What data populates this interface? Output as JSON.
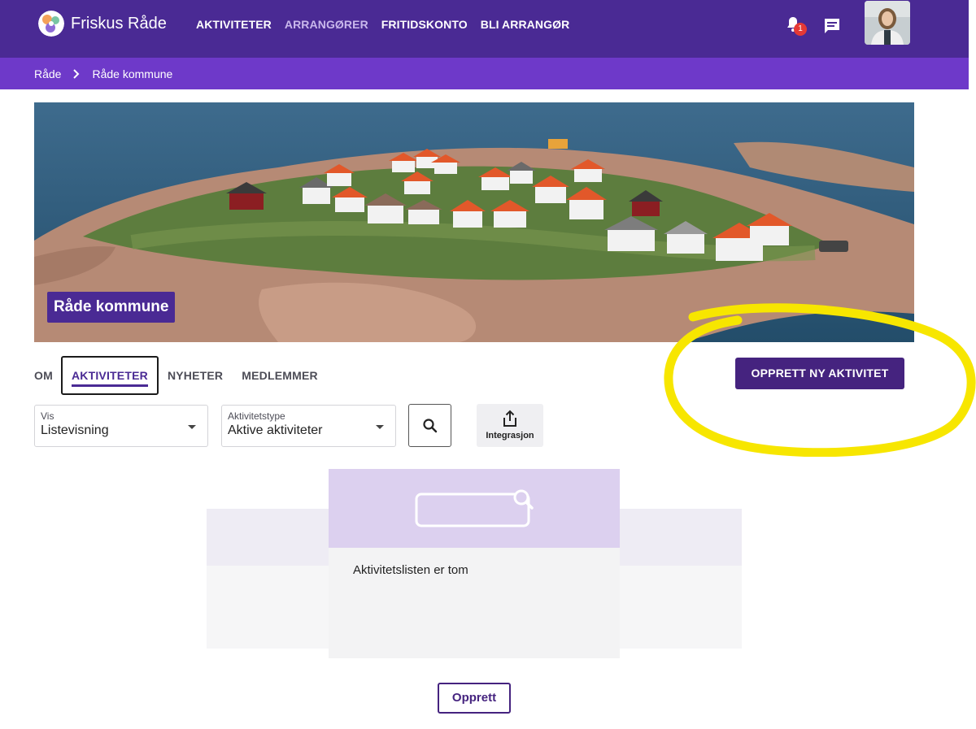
{
  "header": {
    "brand": "Friskus Råde",
    "nav": [
      "AKTIVITETER",
      "ARRANGØRER",
      "FRITIDSKONTO",
      "BLI ARRANGØR"
    ],
    "notifications_count": "1"
  },
  "breadcrumb": [
    "Råde",
    "Råde kommune"
  ],
  "hero": {
    "title": "Råde kommune"
  },
  "tabs": [
    "OM",
    "AKTIVITETER",
    "NYHETER",
    "MEDLEMMER"
  ],
  "create_button": "OPPRETT NY AKTIVITET",
  "filters": {
    "vis": {
      "label": "Vis",
      "value": "Listevisning"
    },
    "type": {
      "label": "Aktivitetstype",
      "value": "Aktive aktiviteter"
    }
  },
  "integration_label": "Integrasjon",
  "empty": {
    "message": "Aktivitetslisten er tom"
  },
  "opprett_button": "Opprett",
  "colors": {
    "primary": "#4a2a94",
    "breadcrumb_bar": "#6e39c9",
    "highlight": "#f7e600"
  }
}
